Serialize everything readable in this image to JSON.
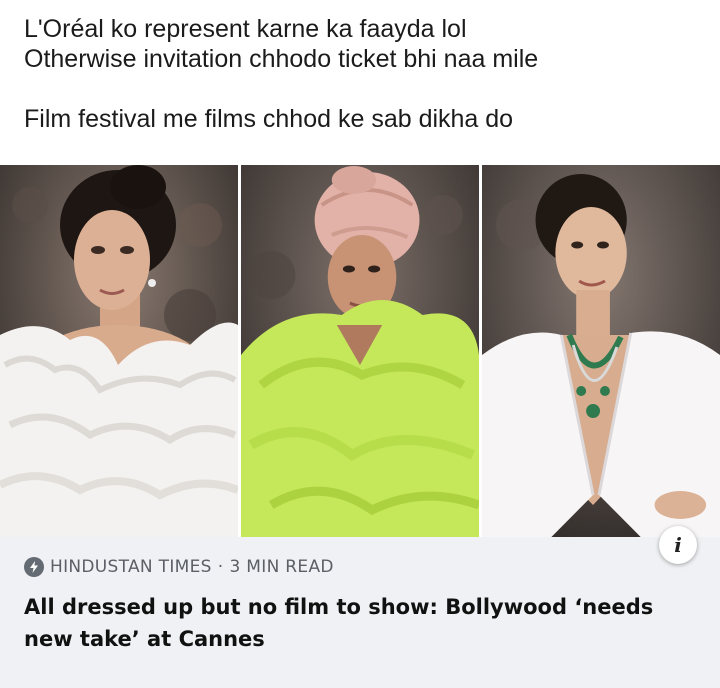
{
  "post": {
    "caption_lines": [
      "L'Oréal ko represent karne ka faayda lol",
      "Otherwise invitation chhodo ticket bhi naa mile",
      "Film festival me films chhod ke sab dikha do"
    ]
  },
  "link_card": {
    "source": "HINDUSTAN TIMES",
    "read_time": "3 MIN READ",
    "separator": "·",
    "headline": "All dressed up but no film to show: Bollywood ‘needs new take’ at Cannes",
    "info_icon": "info-icon"
  },
  "colors": {
    "card_background": "#f0f1f4",
    "source_gray": "#5b5f66",
    "gown_white": "#f4f2f0",
    "gown_lime": "#c4e85a",
    "turban_pink": "#e2b2a8",
    "blazer_white": "#f7f5f6",
    "necklace_green": "#2f7a4f"
  }
}
